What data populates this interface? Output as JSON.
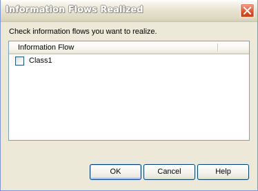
{
  "window": {
    "title": "Information Flows Realized"
  },
  "dialog": {
    "instruction": "Check information flows you want to realize.",
    "list": {
      "columns": [
        "Information Flow",
        ""
      ],
      "rows": [
        {
          "label": "Class1",
          "checked": false
        }
      ]
    },
    "buttons": {
      "ok": "OK",
      "cancel": "Cancel",
      "help": "Help"
    }
  },
  "icons": {
    "close": "close-icon"
  },
  "colors": {
    "dialog_background": "#ece9d8",
    "close_button": "#d5471f",
    "list_border": "#7f9db9",
    "button_border": "#003c74"
  }
}
